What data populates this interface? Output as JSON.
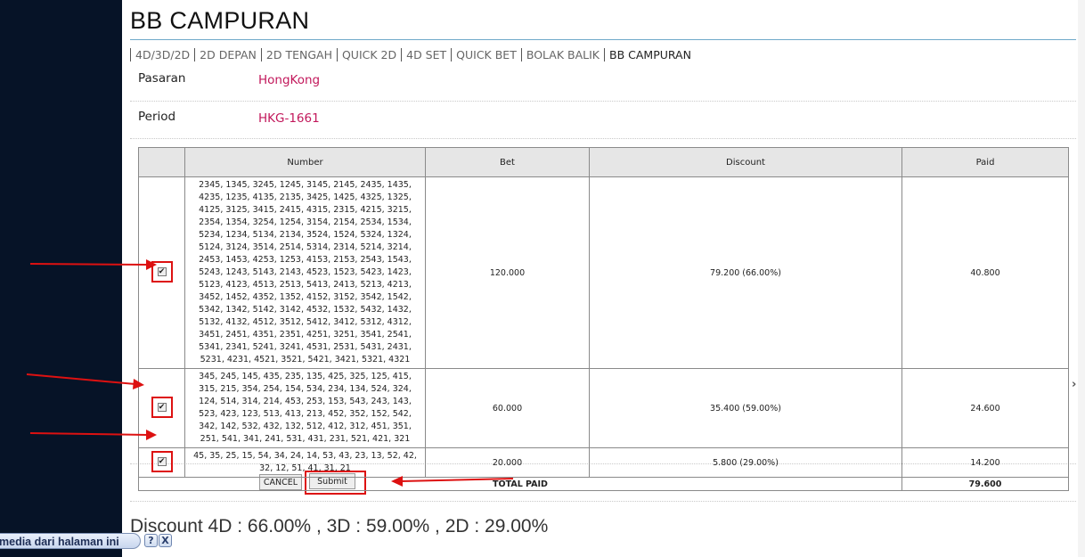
{
  "page": {
    "title": "BB CAMPURAN"
  },
  "tabs": [
    {
      "label": "4D/3D/2D"
    },
    {
      "label": "2D DEPAN"
    },
    {
      "label": "2D TENGAH"
    },
    {
      "label": "QUICK 2D"
    },
    {
      "label": "4D SET"
    },
    {
      "label": "QUICK BET"
    },
    {
      "label": "BOLAK BALIK"
    },
    {
      "label": "BB CAMPURAN",
      "active": true
    }
  ],
  "info": {
    "market_label": "Pasaran",
    "market_value": "HongKong",
    "period_label": "Period",
    "period_value": "HKG-1661"
  },
  "table": {
    "headers": [
      "",
      "Number",
      "Bet",
      "Discount",
      "Paid"
    ],
    "rows": [
      {
        "checked": true,
        "numbers": "2345, 1345, 3245, 1245, 3145, 2145, 2435, 1435, 4235, 1235, 4135, 2135, 3425, 1425, 4325, 1325, 4125, 3125, 3415, 2415, 4315, 2315, 4215, 3215, 2354, 1354, 3254, 1254, 3154, 2154, 2534, 1534, 5234, 1234, 5134, 2134, 3524, 1524, 5324, 1324, 5124, 3124, 3514, 2514, 5314, 2314, 5214, 3214, 2453, 1453, 4253, 1253, 4153, 2153, 2543, 1543, 5243, 1243, 5143, 2143, 4523, 1523, 5423, 1423, 5123, 4123, 4513, 2513, 5413, 2413, 5213, 4213, 3452, 1452, 4352, 1352, 4152, 3152, 3542, 1542, 5342, 1342, 5142, 3142, 4532, 1532, 5432, 1432, 5132, 4132, 4512, 3512, 5412, 3412, 5312, 4312, 3451, 2451, 4351, 2351, 4251, 3251, 3541, 2541, 5341, 2341, 5241, 3241, 4531, 2531, 5431, 2431, 5231, 4231, 4521, 3521, 5421, 3421, 5321, 4321",
        "bet": "120.000",
        "discount": "79.200 (66.00%)",
        "paid": "40.800"
      },
      {
        "checked": true,
        "numbers": "345, 245, 145, 435, 235, 135, 425, 325, 125, 415, 315, 215, 354, 254, 154, 534, 234, 134, 524, 324, 124, 514, 314, 214, 453, 253, 153, 543, 243, 143, 523, 423, 123, 513, 413, 213, 452, 352, 152, 542, 342, 142, 532, 432, 132, 512, 412, 312, 451, 351, 251, 541, 341, 241, 531, 431, 231, 521, 421, 321",
        "bet": "60.000",
        "discount": "35.400 (59.00%)",
        "paid": "24.600"
      },
      {
        "checked": true,
        "numbers": "45, 35, 25, 15, 54, 34, 24, 14, 53, 43, 23, 13, 52, 42, 32, 12, 51, 41, 31, 21",
        "bet": "20.000",
        "discount": "5.800 (29.00%)",
        "paid": "14.200"
      }
    ],
    "total_label": "TOTAL PAID",
    "total_value": "79.600"
  },
  "buttons": {
    "cancel": "CANCEL",
    "submit": "Submit"
  },
  "discount_note": "Discount 4D : 66.00% , 3D : 59.00% , 2D : 29.00%",
  "status_bar": {
    "text": "media dari halaman ini",
    "help_glyph": "?",
    "close_glyph": "X"
  },
  "annotation_color": "#dd1111"
}
